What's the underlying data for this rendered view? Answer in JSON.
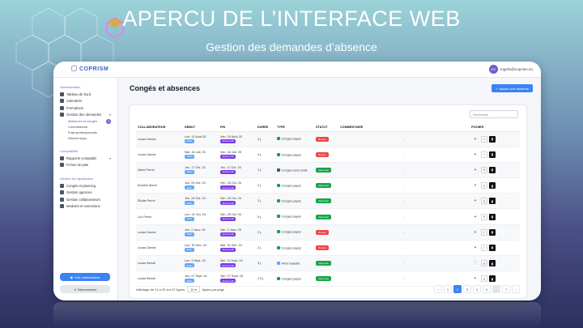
{
  "slide": {
    "title": "APERCU DE L’INTERFACE WEB",
    "subtitle": "Gestion des demandes d’absence"
  },
  "app": {
    "logo": "COPRISM",
    "user_initials": "RG",
    "user_email": "rogelio@coprism.eu"
  },
  "sidebar": {
    "section_admin": "Administration",
    "items_admin": [
      {
        "label": "Tableau de bord",
        "icon": "home-icon"
      },
      {
        "label": "Calendrier",
        "icon": "calendar-icon"
      },
      {
        "label": "Formations",
        "icon": "book-icon"
      },
      {
        "label": "Gestion des demandes",
        "icon": "inbox-icon"
      }
    ],
    "sub_items": [
      {
        "label": "Absences et congés",
        "badge": "3"
      },
      {
        "label": "Commissions"
      },
      {
        "label": "Frais professionnels"
      },
      {
        "label": "Heures supp."
      }
    ],
    "section_compta": "Comptabilité",
    "items_compta": [
      {
        "label": "Rapports comptable",
        "icon": "chart-icon"
      },
      {
        "label": "Fiches de paie",
        "icon": "file-icon"
      }
    ],
    "section_app": "Gestion de l'application",
    "items_app": [
      {
        "label": "Congés et planning",
        "icon": "calendar-icon"
      },
      {
        "label": "Gestion agences",
        "icon": "building-icon"
      },
      {
        "label": "Gestion collaborateurs",
        "icon": "users-icon"
      },
      {
        "label": "Modules et extensions",
        "icon": "puzzle-icon"
      }
    ],
    "btn_collab": "Vue collaborateur",
    "btn_logout": "Déconnexion"
  },
  "main": {
    "title": "Congés et absences",
    "add_button": "Ajouter une absence",
    "search_placeholder": "Recherche",
    "columns": [
      "COLLABORATEUR",
      "DEBUT",
      "FIN",
      "DUREE",
      "TYPE",
      "STATUT",
      "COMMENTAIRE",
      "FICHIER"
    ],
    "rows": [
      {
        "name": "Lucas Garcia",
        "start": "Lun. 11 Août 25",
        "start_tag": "Matin",
        "end": "Ven. 15 Août 25",
        "end_tag": "Après-midi",
        "dur": "4 j.",
        "type": "Congés payés",
        "type_color": "#16a34a",
        "status": "Refusé",
        "status_cls": "red",
        "comment": "-",
        "file": "+",
        "decision": "ok"
      },
      {
        "name": "Lucas Garcia",
        "start": "Mar. 15 Juil. 25",
        "start_tag": "Matin",
        "end": "Ven. 18 Juil. 25",
        "end_tag": "Après-midi",
        "dur": "4 j.",
        "type": "Congés payés",
        "type_color": "#16a34a",
        "status": "Refusé",
        "status_cls": "red",
        "comment": "-",
        "file": "+",
        "decision": "ok"
      },
      {
        "name": "Marie Perrin",
        "start": "Jeu. 17 Oct. 24",
        "start_tag": "Matin",
        "end": "Jeu. 17 Oct. 24",
        "end_tag": "Après-midi",
        "dur": "1 j.",
        "type": "Congés sans solde",
        "type_color": "#4b5563",
        "status": "Approuvé",
        "status_cls": "green",
        "comment": "-",
        "file": "+",
        "decision": "no"
      },
      {
        "name": "Antoine Moret",
        "start": "Jeu. 24 Oct. 24",
        "start_tag": "Matin",
        "end": "Ven. 25 Oct. 24",
        "end_tag": "Après-midi",
        "dur": "2 j.",
        "type": "Congés payés",
        "type_color": "#16a34a",
        "status": "Approuvé",
        "status_cls": "green",
        "comment": "-",
        "file": "+",
        "decision": "no"
      },
      {
        "name": "Élodie Perrin",
        "start": "Jeu. 24 Oct. 24",
        "start_tag": "Matin",
        "end": "Ven. 25 Oct. 24",
        "end_tag": "Après-midi",
        "dur": "2 j.",
        "type": "Congés payés",
        "type_color": "#16a34a",
        "status": "Approuvé",
        "status_cls": "green",
        "comment": "-",
        "file": "+",
        "decision": "no"
      },
      {
        "name": "Luc Perrin",
        "start": "Lun. 21 Oct. 24",
        "start_tag": "Matin",
        "end": "Ven. 25 Oct. 24",
        "end_tag": "Après-midi",
        "dur": "5 j.",
        "type": "Congés payés",
        "type_color": "#16a34a",
        "status": "Approuvé",
        "status_cls": "green",
        "comment": "-",
        "file": "+",
        "decision": "no"
      },
      {
        "name": "Lucas Garcia",
        "start": "Jeu. 2 Janv. 25",
        "start_tag": "Matin",
        "end": "Ven. 3 Janv. 25",
        "end_tag": "Après-midi",
        "dur": "2 j.",
        "type": "Congés payés",
        "type_color": "#16a34a",
        "status": "Refusé",
        "status_cls": "red",
        "comment": "-",
        "file": "+",
        "decision": "ok"
      },
      {
        "name": "Lucas Garcia",
        "start": "Lun. 30 Déc. 24",
        "start_tag": "Matin",
        "end": "Mar. 31 Déc. 24",
        "end_tag": "Après-midi",
        "dur": "2 j.",
        "type": "Congés payés",
        "type_color": "#16a34a",
        "status": "Refusé",
        "status_cls": "red",
        "comment": "-",
        "file": "+",
        "decision": "ok"
      },
      {
        "name": "Lucas Benoit",
        "start": "Lun. 9 Sept. 24",
        "start_tag": "Matin",
        "end": "Mer. 11 Sept. 24",
        "end_tag": "Après-midi",
        "dur": "3 j.",
        "type": "Arrêt maladie",
        "type_color": "#60a5fa",
        "status": "Approuvé",
        "status_cls": "green",
        "comment": "-",
        "file": "📄",
        "decision": "no"
      },
      {
        "name": "Lucas Benoit",
        "start": "Jeu. 27 Sept. 24",
        "start_tag": "Matin",
        "end": "Ven. 27 Sept. 24",
        "end_tag": "Après-midi",
        "dur": "1.5 j.",
        "type": "Congés payés",
        "type_color": "#16a34a",
        "status": "Approuvé",
        "status_cls": "green",
        "comment": "-",
        "file": "+",
        "decision": "no"
      }
    ],
    "footer_prefix": "Affichage de 11 à 20 sur 67 lignes",
    "page_size": "10",
    "footer_suffix": "lignes par page",
    "pages": [
      "‹",
      "1",
      "2",
      "3",
      "4",
      "5",
      "…",
      "7",
      "›"
    ],
    "active_page": "2"
  }
}
